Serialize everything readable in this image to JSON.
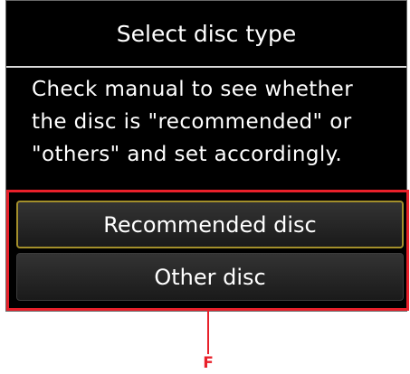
{
  "dialog": {
    "title": "Select disc type",
    "message_lines": [
      "Check manual to see whether",
      "the disc is \"recommended\" or",
      "\"others\" and set accordingly."
    ],
    "buttons": {
      "recommended": "Recommended disc",
      "other": "Other disc"
    }
  },
  "annotation": {
    "label": "F",
    "color": "#e8202a"
  }
}
